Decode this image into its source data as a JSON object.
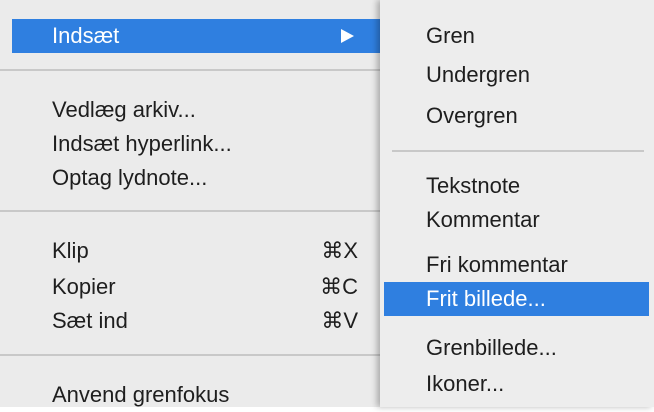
{
  "main_menu": {
    "insert": "Indsæt",
    "attach_file": "Vedlæg arkiv...",
    "insert_hyperlink": "Indsæt hyperlink...",
    "record_audio": "Optag lydnote...",
    "cut": "Klip",
    "cut_shortcut": "⌘X",
    "copy": "Kopier",
    "copy_shortcut": "⌘C",
    "paste": "Sæt ind",
    "paste_shortcut": "⌘V",
    "branch_focus": "Anvend grenfokus"
  },
  "submenu": {
    "topic": "Gren",
    "subtopic": "Undergren",
    "parent_topic": "Overgren",
    "text_note": "Tekstnote",
    "comment": "Kommentar",
    "free_comment": "Fri kommentar",
    "free_image": "Frit billede...",
    "topic_image": "Grenbillede...",
    "icons": "Ikoner..."
  },
  "colors": {
    "highlight": "#2f7fe0",
    "menu_bg": "#ebebeb",
    "separator": "#c8c8c8"
  }
}
